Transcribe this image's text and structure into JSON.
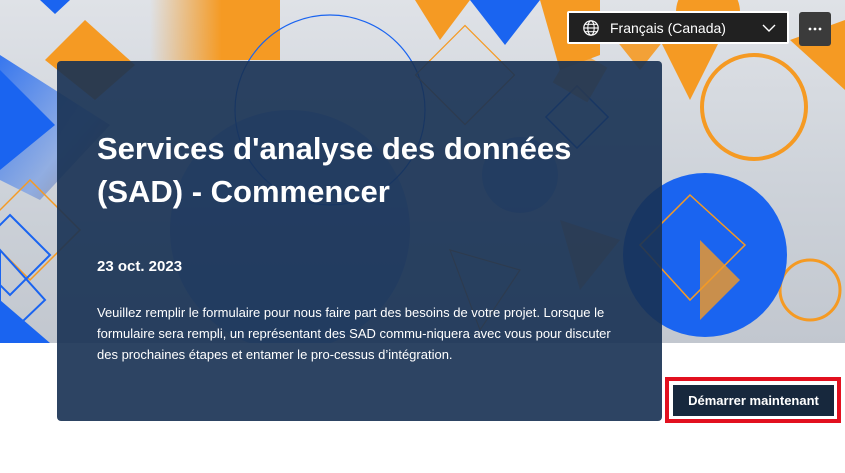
{
  "header": {
    "language_label": "Français (Canada)",
    "globe_icon": "globe-icon",
    "dropdown_icon": "chevron-down-icon",
    "more_icon": "more-horizontal-icon"
  },
  "card": {
    "title": "Services d'analyse des données (SAD) - Commencer",
    "date": "23 oct. 2023",
    "description": "Veuillez remplir le formulaire pour nous faire part des besoins de votre projet. Lorsque le formulaire sera rempli, un représentant des SAD commu-niquera avec vous pour discuter des prochaines étapes et entamer le pro-cessus d’intégration."
  },
  "actions": {
    "start_label": "Démarrer maintenant"
  },
  "colors": {
    "accent_blue": "#1a64f0",
    "accent_orange": "#f59a23",
    "card_background": "#183254",
    "highlight_red": "#e2101f"
  }
}
